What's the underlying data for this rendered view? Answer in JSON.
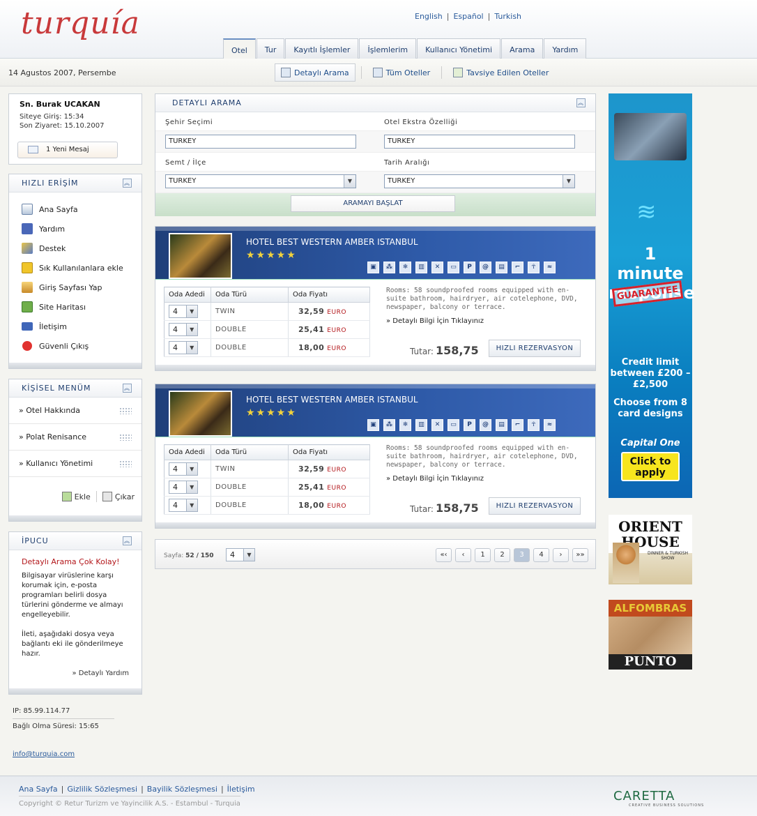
{
  "app": {
    "logo": "turquía"
  },
  "langs": [
    "English",
    "Español",
    "Turkish"
  ],
  "tabs": [
    "Otel",
    "Tur",
    "Kayıtlı İşlemler",
    "İşlemlerim",
    "Kullanıcı Yönetimi",
    "Arama",
    "Yardım"
  ],
  "date": "14 Agustos 2007, Persembe",
  "subnav": [
    "Detaylı Arama",
    "Tüm Oteller",
    "Tavsiye Edilen Oteller"
  ],
  "user": {
    "name": "Sn. Burak UCAKAN",
    "login_label": "Siteye Giriş:",
    "login_time": "15:34",
    "last_label": "Son Ziyaret:",
    "last_date": "15.10.2007",
    "msg": "1 Yeni Mesaj"
  },
  "quick": {
    "title": "HIZLI ERİŞİM",
    "items": [
      "Ana Sayfa",
      "Yardım",
      "Destek",
      "Sık Kullanılanlara ekle",
      "Giriş Sayfası Yap",
      "Site Haritası",
      "İletişim",
      "Güvenli Çıkış"
    ]
  },
  "menu": {
    "title": "KİŞİSEL MENÜM",
    "items": [
      "» Otel Hakkında",
      "» Polat Renisance",
      "» Kullanıcı Yönetimi"
    ],
    "add": "Ekle",
    "remove": "Çıkar"
  },
  "tip": {
    "title": "İPUCU",
    "heading": "Detaylı Arama Çok Kolay!",
    "p1": "Bilgisayar virüslerine karşı korumak için, e-posta programları belirli dosya türlerini gönderme ve almayı engelleyebilir.",
    "p2": "İleti, aşağıdaki dosya veya bağlantı eki ile gönderilmeye hazır.",
    "more": "» Detaylı Yardım"
  },
  "status": {
    "ip": "IP: 85.99.114.77",
    "conn": "Bağlı Olma Süresi: 15:65",
    "email": "info@turquia.com"
  },
  "search": {
    "title": "DETAYLI ARAMA",
    "city_label": "Şehir Seçimi",
    "city": "TURKEY",
    "extra_label": "Otel Ekstra Özelliği",
    "extra": "TURKEY",
    "district_label": "Semt / İlçe",
    "district": "TURKEY",
    "date_label": "Tarih Aralığı",
    "date": "TURKEY",
    "button": "ARAMAYI BAŞLAT"
  },
  "hotels": [
    {
      "name": "HOTEL BEST WESTERN AMBER ISTANBUL",
      "stars": "★★★★★",
      "col_qty": "Oda Adedi",
      "col_type": "Oda Türü",
      "col_price": "Oda Fiyatı",
      "rooms": [
        {
          "qty": "4",
          "type": "TWIN",
          "price": "32,59",
          "cur": "EURO"
        },
        {
          "qty": "4",
          "type": "DOUBLE",
          "price": "25,41",
          "cur": "EURO"
        },
        {
          "qty": "4",
          "type": "DOUBLE",
          "price": "18,00",
          "cur": "EURO"
        }
      ],
      "desc": "Rooms: 58 soundproofed rooms equipped with en-suite bathroom, hairdryer, air cotelephone, DVD, newspaper, balcony or terrace.",
      "details": "» Detaylı Bilgi İçin Tıklayınız",
      "total_label": "Tutar:",
      "total": "158,75",
      "button": "HIZLI REZERVASYON"
    },
    {
      "name": "HOTEL BEST WESTERN AMBER ISTANBUL",
      "stars": "★★★★★",
      "col_qty": "Oda Adedi",
      "col_type": "Oda Türü",
      "col_price": "Oda Fiyatı",
      "rooms": [
        {
          "qty": "4",
          "type": "TWIN",
          "price": "32,59",
          "cur": "EURO"
        },
        {
          "qty": "4",
          "type": "DOUBLE",
          "price": "25,41",
          "cur": "EURO"
        },
        {
          "qty": "4",
          "type": "DOUBLE",
          "price": "18,00",
          "cur": "EURO"
        }
      ],
      "desc": "Rooms: 58 soundproofed rooms equipped with en-suite bathroom, hairdryer, air cotelephone, DVD, newspaper, balcony or terrace.",
      "details": "» Detaylı Bilgi İçin Tıklayınız",
      "total_label": "Tutar:",
      "total": "158,75",
      "button": "HIZLI REZERVASYON"
    }
  ],
  "pager": {
    "label": "Sayfa:",
    "current": "52",
    "sep": "/",
    "total": "150",
    "perpage": "4",
    "buttons": [
      "«‹",
      "‹",
      "1",
      "2",
      "3",
      "4",
      "›",
      "»»"
    ],
    "active": "3"
  },
  "ads": {
    "a1_t1": "1 minute response",
    "a1_stamp": "GUARANTEE",
    "a1_t2": "Credit limit between £200 – £2,500",
    "a1_t3": "Choose from 8 card designs",
    "a1_logo": "Capital One",
    "a1_btn": "Click to apply",
    "a2_t": "ORIENT HOUSE",
    "a2_s": "DINNER & TURKISH SHOW",
    "a3_t": "ALFOMBRAS",
    "a3_p": "PUNTO"
  },
  "footer": {
    "links": [
      "Ana Sayfa",
      "Gizlilik Sözleşmesi",
      "Bayilik Sözleşmesi",
      "İletişim"
    ],
    "copy": "Copyright © Retur Turizm ve Yayincilik A.S. - Estambul - Turquia",
    "brand": "CARETTA",
    "brand_sub": "CREATIVE BUSINESS SOLUTIONS"
  },
  "colors": {
    "accent": "#1f3f7a",
    "brand": "#c8393a",
    "link": "#2a5a9b"
  }
}
